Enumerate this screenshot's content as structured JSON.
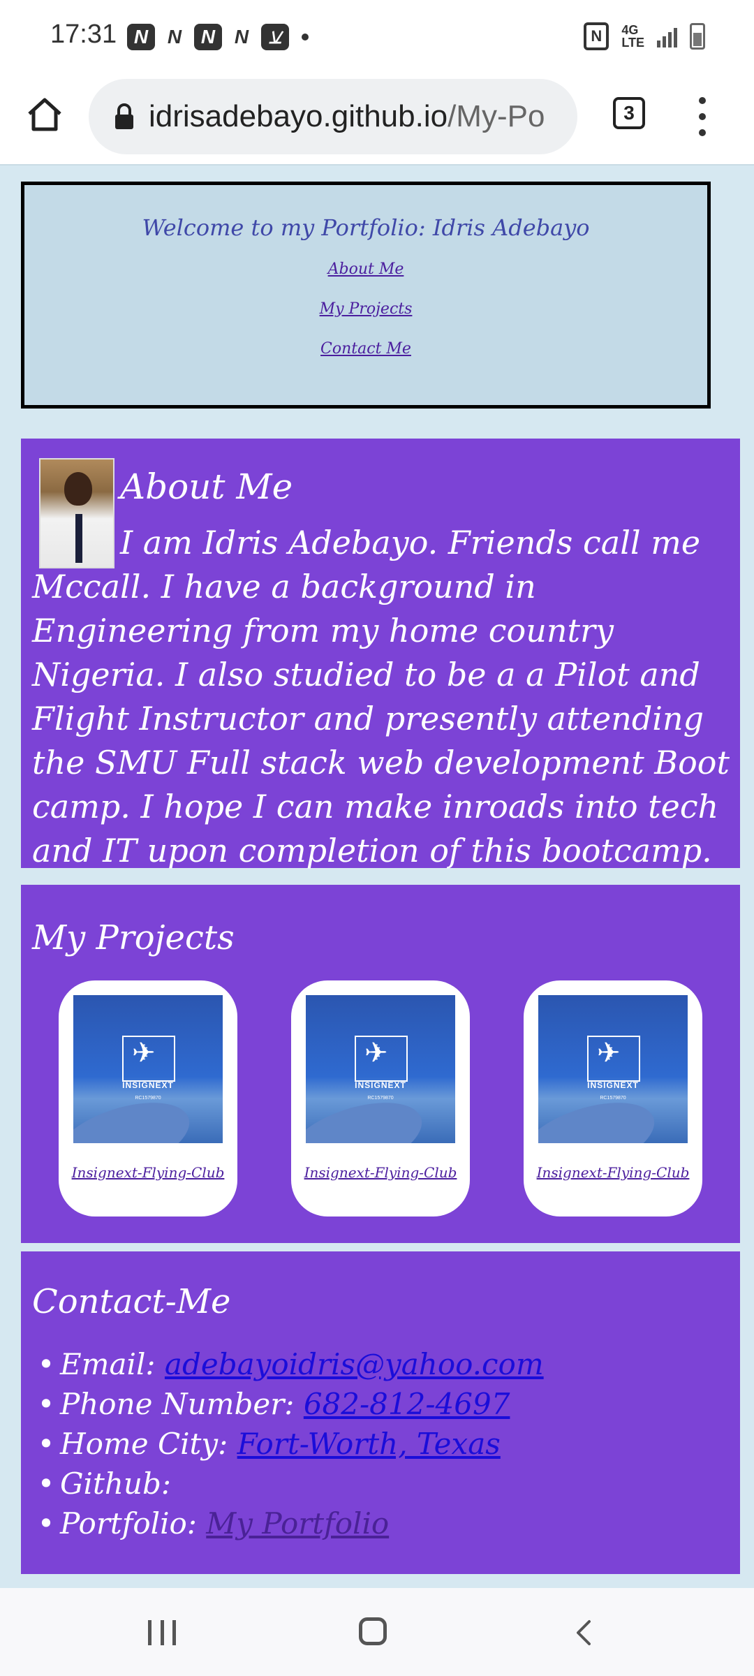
{
  "status_bar": {
    "time": "17:31",
    "notification_icons": [
      "N",
      "N",
      "N",
      "N",
      "mosque-icon"
    ],
    "right_icons": [
      "nfc-icon",
      "4g-lte-icon",
      "signal-icon",
      "battery-icon"
    ],
    "lte_label": "4G LTE"
  },
  "browser": {
    "url_domain": "idrisadebayo.github.io",
    "url_path": "/My-Po",
    "tab_count": "3"
  },
  "header": {
    "title": "Welcome to my Portfolio: Idris Adebayo",
    "nav": {
      "about": "About Me",
      "projects": "My Projects",
      "contact": "Contact Me"
    }
  },
  "about": {
    "heading": "About Me",
    "text": "I am Idris Adebayo. Friends call me Mccall. I have a background in Engineering from my home country Nigeria. I also studied to be a a Pilot and Flight Instructor and presently attending the SMU Full stack web development Boot camp. I hope I can make inroads into tech and IT upon completion of this bootcamp."
  },
  "projects": {
    "heading": "My Projects",
    "items": [
      {
        "label": "Insignext-Flying-Club",
        "logo_text": "INSIGNEXT",
        "logo_sub": "RC1579870"
      },
      {
        "label": "Insignext-Flying-Club",
        "logo_text": "INSIGNEXT",
        "logo_sub": "RC1579870"
      },
      {
        "label": "Insignext-Flying-Club",
        "logo_text": "INSIGNEXT",
        "logo_sub": "RC1579870"
      }
    ]
  },
  "contact": {
    "heading": "Contact-Me",
    "email_label": "Email:",
    "email_value": "adebayoidris@yahoo.com",
    "phone_label": "Phone Number:",
    "phone_value": "682-812-4697",
    "city_label": "Home City:",
    "city_value": "Fort-Worth, Texas",
    "github_label": "Github:",
    "portfolio_label": "Portfolio:",
    "portfolio_value": "My Portfolio"
  },
  "colors": {
    "page_bg": "#d6e8f1",
    "header_bg": "#c3dae7",
    "section_bg": "#7c43d6",
    "link": "#1a0dd9",
    "visited_link": "#4a2296"
  }
}
